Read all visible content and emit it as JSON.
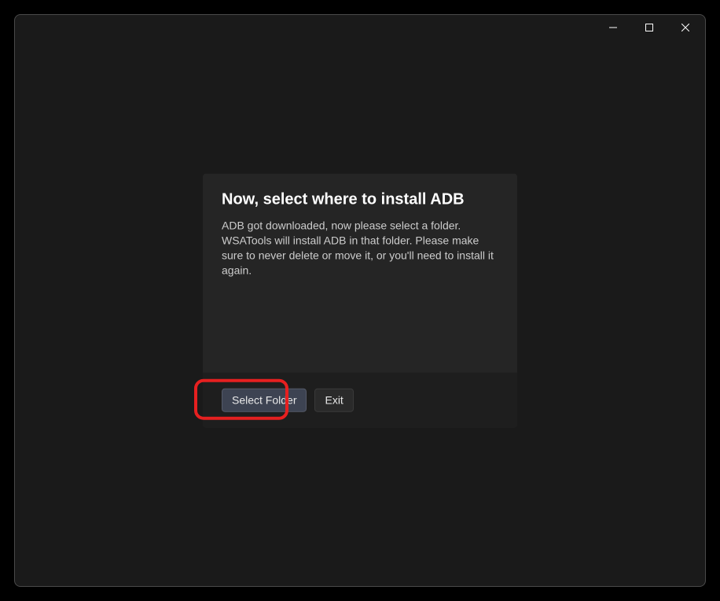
{
  "window": {
    "controls": {
      "minimize": "Minimize",
      "maximize": "Maximize",
      "close": "Close"
    }
  },
  "dialog": {
    "title": "Now, select where to install ADB",
    "body": "ADB got downloaded, now please select a folder. WSATools will install ADB in that folder. Please make sure to never delete or move it, or you'll need to install it again.",
    "primary_button": "Select Folder",
    "secondary_button": "Exit"
  }
}
